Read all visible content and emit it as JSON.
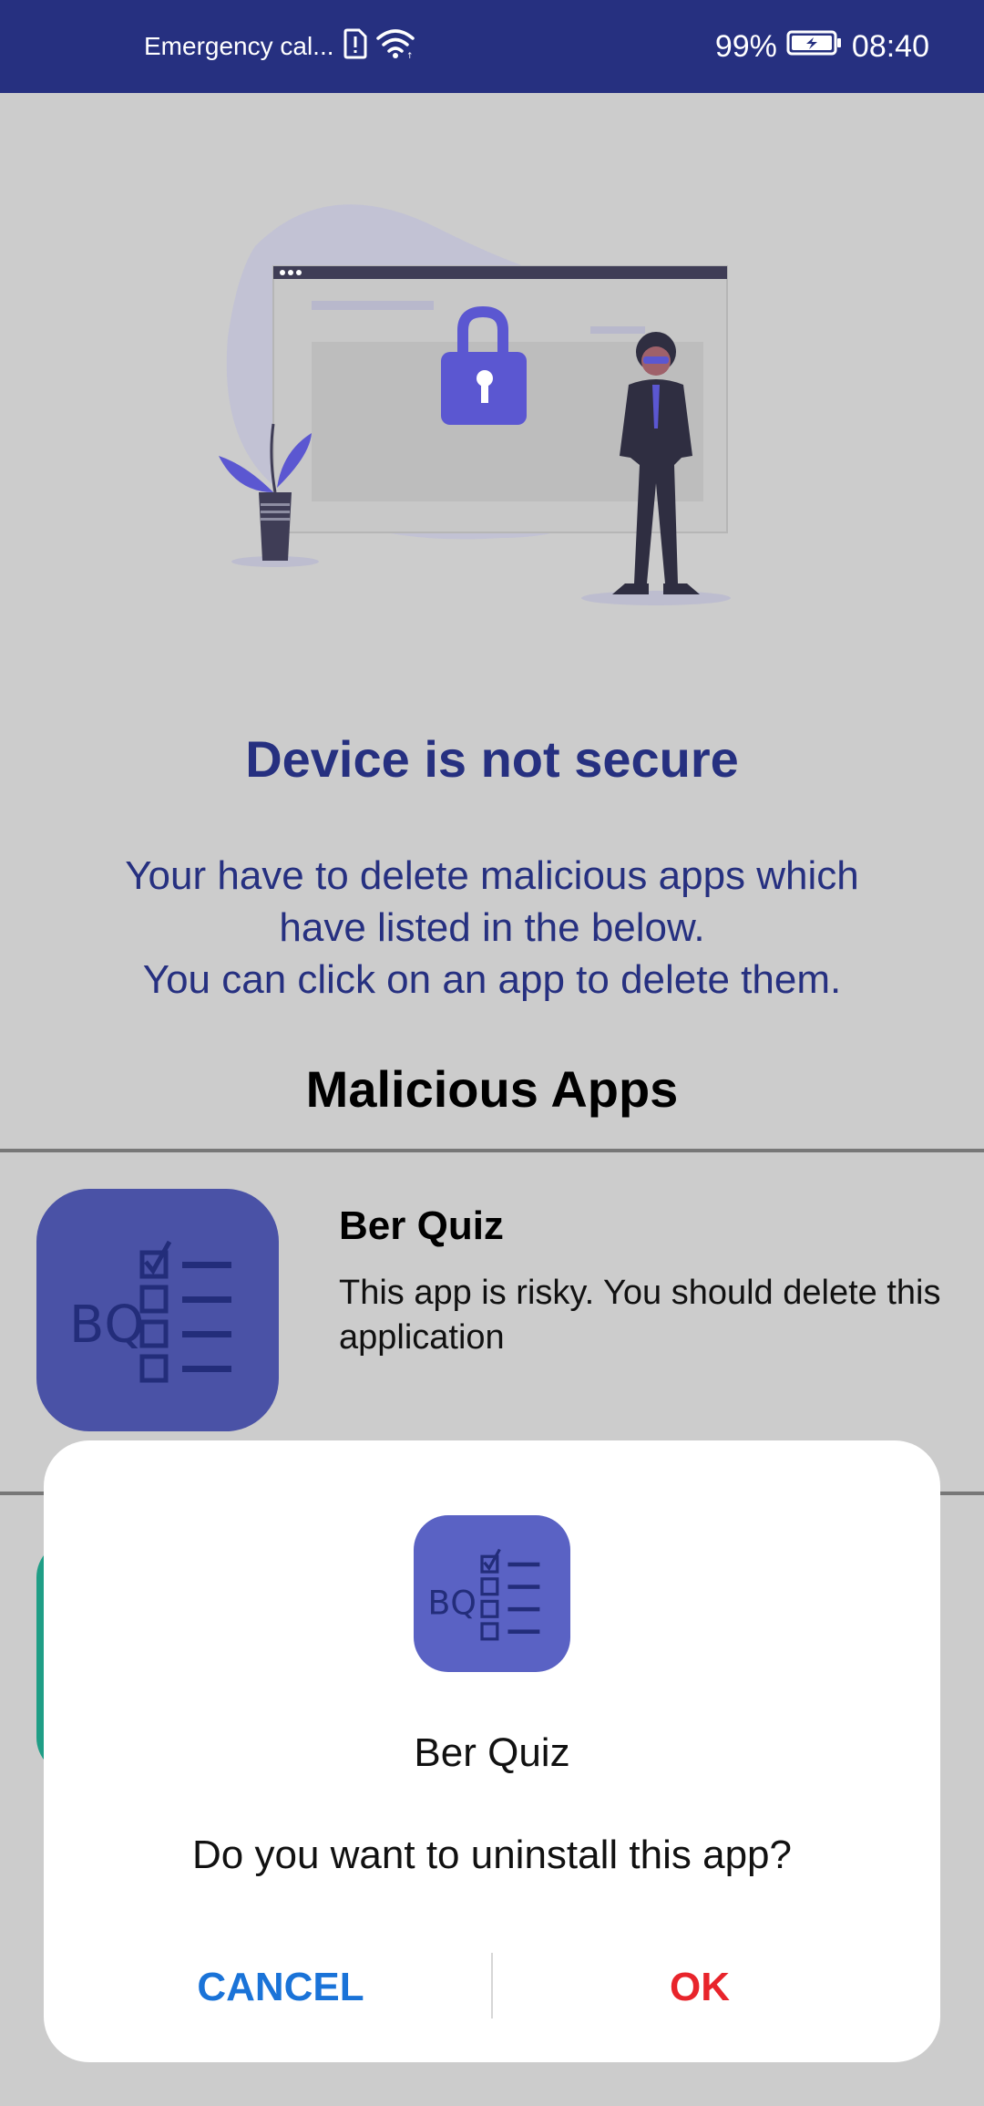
{
  "status_bar": {
    "carrier": "Emergency cal...",
    "battery": "99%",
    "time": "08:40",
    "icons": [
      "sim-alert-icon",
      "wifi-icon",
      "battery-charging-icon"
    ]
  },
  "colors": {
    "status_bar_bg": "#263080",
    "background": "#cccccc",
    "title": "#263080",
    "icon_bg": "#4a52a6",
    "cancel": "#1a73d8",
    "ok": "#e8242b"
  },
  "main": {
    "title": "Device is not secure",
    "description_lines": [
      "Your have to delete malicious apps which",
      "have listed in the below.",
      "You can click on an app to delete them."
    ],
    "section_title": "Malicious Apps"
  },
  "apps": [
    {
      "name": "Ber Quiz",
      "description": "This app is risky. You should delete this application",
      "icon_text": "BQ"
    }
  ],
  "dialog": {
    "app_name": "Ber Quiz",
    "message": "Do you want to uninstall this app?",
    "cancel_label": "CANCEL",
    "ok_label": "OK",
    "icon_text": "BQ"
  }
}
